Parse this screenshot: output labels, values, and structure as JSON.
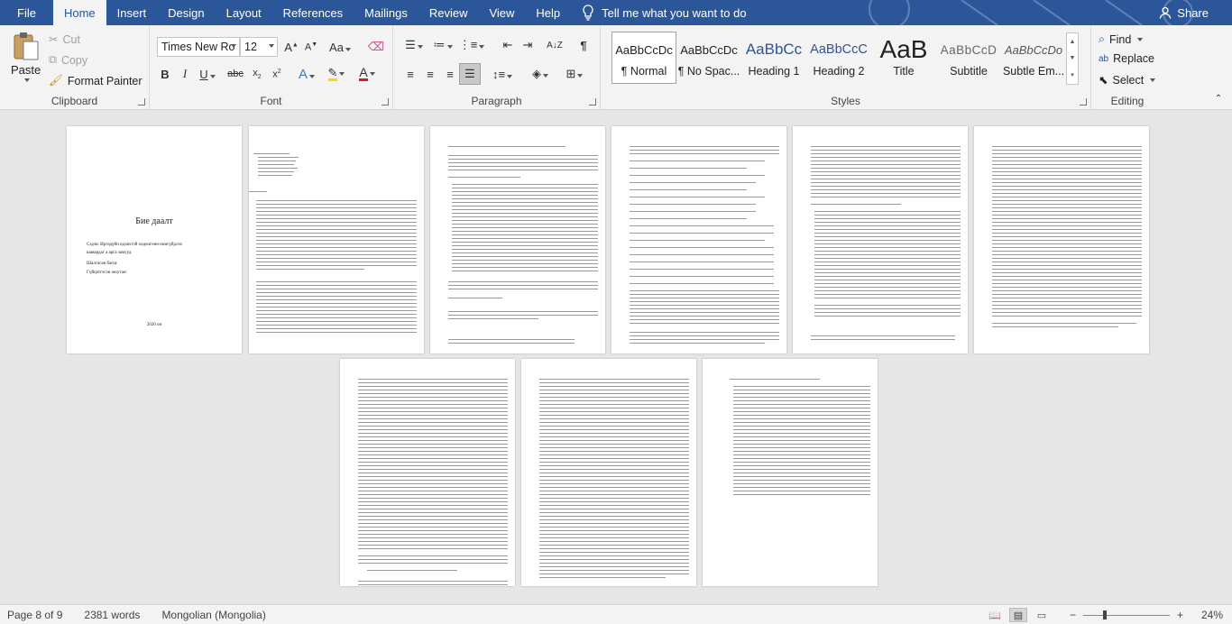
{
  "tabs": {
    "file": "File",
    "items": [
      "Home",
      "Insert",
      "Design",
      "Layout",
      "References",
      "Mailings",
      "Review",
      "View",
      "Help"
    ],
    "tell_me": "Tell me what you want to do",
    "share": "Share"
  },
  "clipboard": {
    "paste": "Paste",
    "cut": "Cut",
    "copy": "Copy",
    "format_painter": "Format Painter",
    "label": "Clipboard"
  },
  "font": {
    "name": "Times New Ro",
    "size": "12",
    "label": "Font"
  },
  "paragraph": {
    "label": "Paragraph"
  },
  "styles": {
    "label": "Styles",
    "items": [
      {
        "preview": "AaBbCcDc",
        "name": "¶ Normal"
      },
      {
        "preview": "AaBbCcDc",
        "name": "¶ No Spac..."
      },
      {
        "preview": "AaBbCc",
        "name": "Heading 1"
      },
      {
        "preview": "AaBbCcC",
        "name": "Heading 2"
      },
      {
        "preview": "AaB",
        "name": "Title"
      },
      {
        "preview": "AaBbCcD",
        "name": "Subtitle"
      },
      {
        "preview": "AaBbCcDo",
        "name": "Subtle Em..."
      }
    ]
  },
  "editing": {
    "find": "Find",
    "replace": "Replace",
    "select": "Select",
    "label": "Editing"
  },
  "document": {
    "cover_title": "Бие даалт",
    "cover_lines": [
      "Сэдэв: Ирээдүйн идэвхтэй хөдөлгөөн номгүйдлэх",
      "шавардаг а арга замууд",
      "Шалгасан багш:",
      "Гүйцэтгэсэн оюутан:"
    ],
    "cover_year": "2020 он"
  },
  "status": {
    "page": "Page 8 of 9",
    "words": "2381 words",
    "language": "Mongolian (Mongolia)",
    "zoom": "24%"
  },
  "colors": {
    "ribbon_blue": "#2b579a",
    "font_color_underline": "#d21f1f",
    "highlight_underline": "#ffd700"
  }
}
